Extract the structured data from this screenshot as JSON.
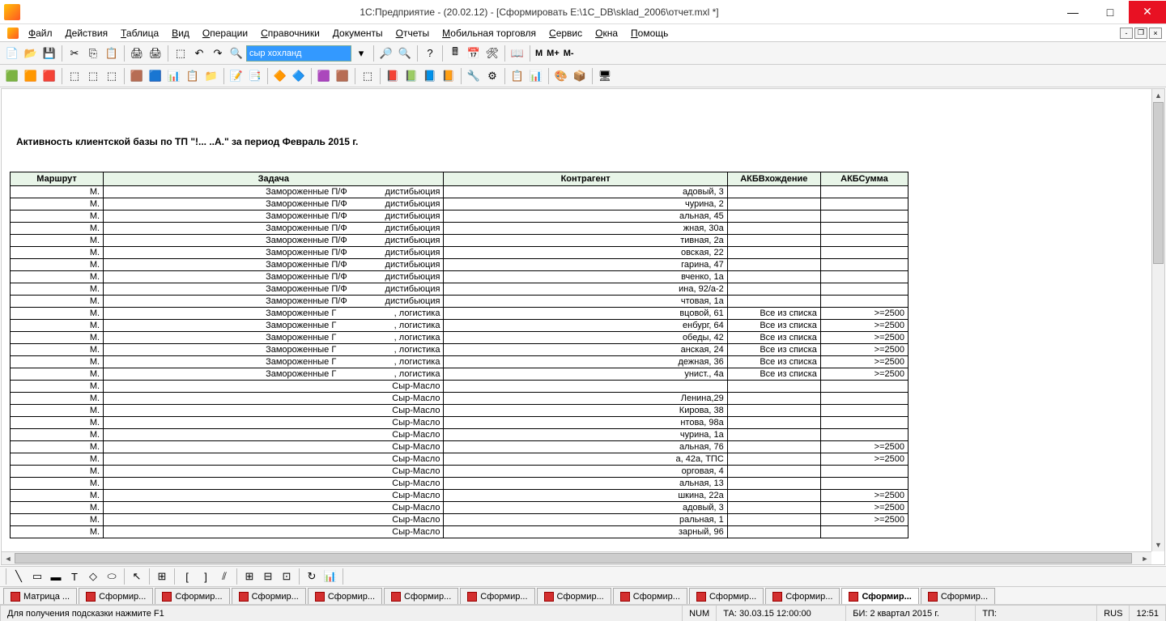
{
  "title": "1С:Предприятие -            (20.02.12) - [Сформировать E:\\1C_DB\\sklad_2006\\отчет.mxl *]",
  "menu": [
    "Файл",
    "Действия",
    "Таблица",
    "Вид",
    "Операции",
    "Справочники",
    "Документы",
    "Отчеты",
    "Мобильная торговля",
    "Сервис",
    "Окна",
    "Помощь"
  ],
  "search_value": "сыр хохланд",
  "m_labels": {
    "m": "М",
    "mp": "М+",
    "mm": "М-"
  },
  "report_title": "Активность клиентской базы  по ТП \"!...      ..А.\" за период Февраль 2015 г.",
  "columns": {
    "route": "Маршрут",
    "task": "Задача",
    "agent": "Контрагент",
    "akb1": "АКБВхождение",
    "akb2": "АКБСумма"
  },
  "rows": [
    {
      "r": "М.",
      "t": "Замороженные П/Ф",
      "t2": "дистибьюция",
      "a": "адовый, 3",
      "v1": "",
      "v2": ""
    },
    {
      "r": "М.",
      "t": "Замороженные П/Ф",
      "t2": "дистибьюция",
      "a": "чурина, 2",
      "v1": "",
      "v2": ""
    },
    {
      "r": "М.",
      "t": "Замороженные П/Ф",
      "t2": "дистибьюция",
      "a": "альная, 45",
      "v1": "",
      "v2": ""
    },
    {
      "r": "М.",
      "t": "Замороженные П/Ф",
      "t2": "дистибьюция",
      "a": "жная, 30а",
      "v1": "",
      "v2": ""
    },
    {
      "r": "М.",
      "t": "Замороженные П/Ф",
      "t2": "дистибьюция",
      "a": "тивная, 2а",
      "v1": "",
      "v2": ""
    },
    {
      "r": "М.",
      "t": "Замороженные П/Ф",
      "t2": "дистибьюция",
      "a": "овская, 22",
      "v1": "",
      "v2": ""
    },
    {
      "r": "М.",
      "t": "Замороженные П/Ф",
      "t2": "дистибьюция",
      "a": "гарина, 47",
      "v1": "",
      "v2": ""
    },
    {
      "r": "М.",
      "t": "Замороженные П/Ф",
      "t2": "дистибьюция",
      "a": "вченко, 1а",
      "v1": "",
      "v2": ""
    },
    {
      "r": "М.",
      "t": "Замороженные П/Ф",
      "t2": "дистибьюция",
      "a": "ина, 92/а-2",
      "v1": "",
      "v2": ""
    },
    {
      "r": "М.",
      "t": "Замороженные П/Ф",
      "t2": "дистибьюция",
      "a": "чтовая, 1а",
      "v1": "",
      "v2": ""
    },
    {
      "r": "М.",
      "t": "Замороженные Г",
      "t2": ", логистика",
      "a": "вцовой, 61",
      "v1": "Все из списка",
      "v2": ">=2500"
    },
    {
      "r": "М.",
      "t": "Замороженные Г",
      "t2": ", логистика",
      "a": "енбург, 64",
      "v1": "Все из списка",
      "v2": ">=2500"
    },
    {
      "r": "М.",
      "t": "Замороженные Г",
      "t2": ", логистика",
      "a": "обеды, 42",
      "v1": "Все из списка",
      "v2": ">=2500"
    },
    {
      "r": "М.",
      "t": "Замороженные Г",
      "t2": ", логистика",
      "a": "анская, 24",
      "v1": "Все из списка",
      "v2": ">=2500"
    },
    {
      "r": "М.",
      "t": "Замороженные Г",
      "t2": ", логистика",
      "a": "дежная, 36",
      "v1": "Все из списка",
      "v2": ">=2500"
    },
    {
      "r": "М.",
      "t": "Замороженные Г",
      "t2": ", логистика",
      "a": "унист., 4а",
      "v1": "Все из списка",
      "v2": ">=2500"
    },
    {
      "r": "М.",
      "t": "",
      "t2": "Сыр-Масло",
      "a": "",
      "v1": "",
      "v2": ""
    },
    {
      "r": "М.",
      "t": "",
      "t2": "Сыр-Масло",
      "a": "Ленина,29",
      "v1": "",
      "v2": ""
    },
    {
      "r": "М.",
      "t": "",
      "t2": "Сыр-Масло",
      "a": "Кирова, 38",
      "v1": "",
      "v2": ""
    },
    {
      "r": "М.",
      "t": "",
      "t2": "Сыр-Масло",
      "a": "нтова, 98а",
      "v1": "",
      "v2": ""
    },
    {
      "r": "М.",
      "t": "",
      "t2": "Сыр-Масло",
      "a": "чурина, 1а",
      "v1": "",
      "v2": ""
    },
    {
      "r": "М.",
      "t": "",
      "t2": "Сыр-Масло",
      "a": "альная, 76",
      "v1": "",
      "v2": ">=2500"
    },
    {
      "r": "М.",
      "t": "",
      "t2": "Сыр-Масло",
      "a": "а, 42а, ТПС",
      "v1": "",
      "v2": ">=2500"
    },
    {
      "r": "М.",
      "t": "",
      "t2": "Сыр-Масло",
      "a": "орговая, 4",
      "v1": "",
      "v2": ""
    },
    {
      "r": "М.",
      "t": "",
      "t2": "Сыр-Масло",
      "a": "альная, 13",
      "v1": "",
      "v2": ""
    },
    {
      "r": "М.",
      "t": "",
      "t2": "Сыр-Масло",
      "a": "шкина, 22а",
      "v1": "",
      "v2": ">=2500"
    },
    {
      "r": "М.",
      "t": "",
      "t2": "Сыр-Масло",
      "a": "адовый, 3",
      "v1": "",
      "v2": ">=2500"
    },
    {
      "r": "М.",
      "t": "",
      "t2": "Сыр-Масло",
      "a": "ральная, 1",
      "v1": "",
      "v2": ">=2500"
    },
    {
      "r": "М.",
      "t": "",
      "t2": "Сыр-Масло",
      "a": "зарный, 96",
      "v1": "",
      "v2": ""
    }
  ],
  "tabs": [
    "Матрица ...",
    "Сформир...",
    "Сформир...",
    "Сформир...",
    "Сформир...",
    "Сформир...",
    "Сформир...",
    "Сформир...",
    "Сформир...",
    "Сформир...",
    "Сформир...",
    "Сформир...",
    "Сформир..."
  ],
  "active_tab_index": 11,
  "status": {
    "hint": "Для получения подсказки нажмите F1",
    "num": "NUM",
    "ta": "ТА: 30.03.15  12:00:00",
    "bi": "БИ: 2 квартал 2015 г.",
    "tp": "ТП:",
    "lang": "RUS",
    "time": "12:51"
  }
}
